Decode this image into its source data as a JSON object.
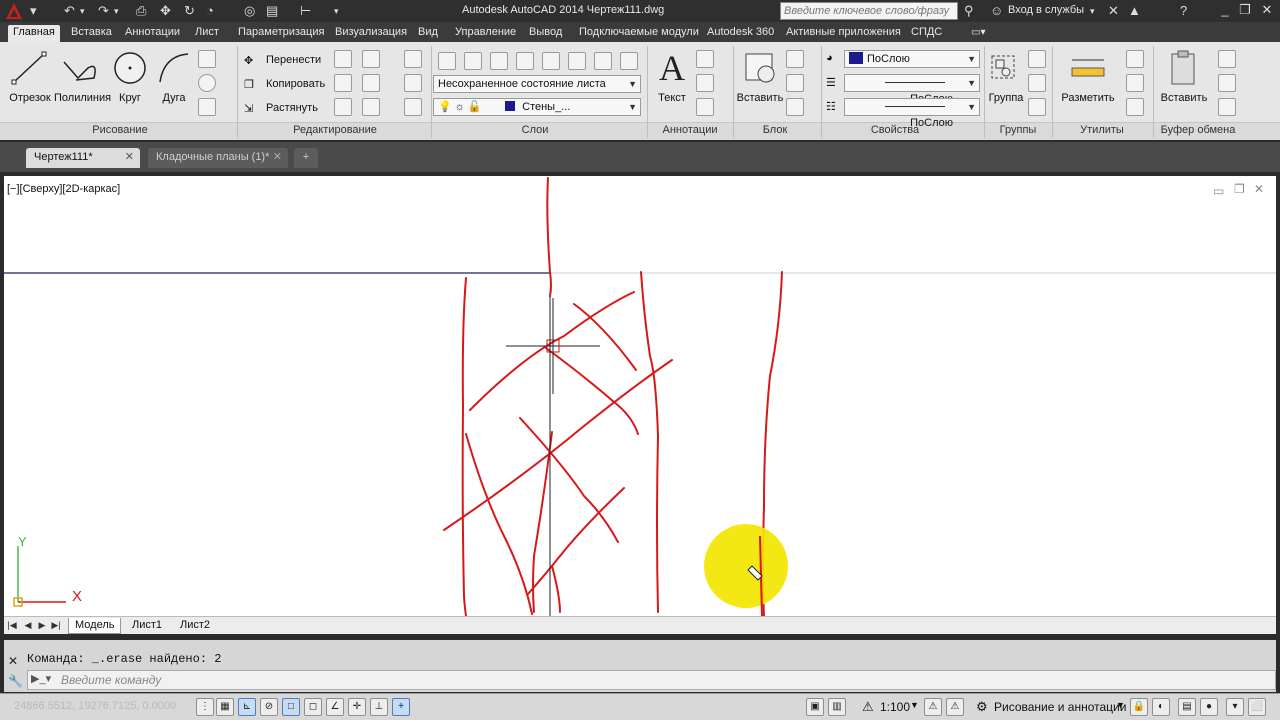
{
  "window": {
    "title": "Autodesk AutoCAD 2014   Чертеж111.dwg",
    "search_placeholder": "Введите ключевое слово/фразу",
    "signin_label": "Вход в службы",
    "logo_letter": "A"
  },
  "ribbon_tabs": [
    "Главная",
    "Вставка",
    "Аннотации",
    "Лист",
    "Параметризация",
    "Визуализация",
    "Вид",
    "Управление",
    "Вывод",
    "Подключаемые модули",
    "Autodesk 360",
    "Активные приложения",
    "СПДС"
  ],
  "draw_panel": {
    "tools": [
      "Отрезок",
      "Полилиния",
      "Круг",
      "Дуга"
    ],
    "title": "Рисование"
  },
  "modify_panel": {
    "move": "Перенести",
    "copy": "Копировать",
    "stretch": "Растянуть",
    "title": "Редактирование"
  },
  "layers_panel": {
    "layer_state": "Несохраненное состояние листа",
    "current_layer": "Стены_...",
    "title": "Слои"
  },
  "annotation_panel": {
    "text_tool": "Текст",
    "title": "Аннотации"
  },
  "block_panel": {
    "insert_tool": "Вставить",
    "title": "Блок"
  },
  "properties_panel": {
    "color": "ПоСлою",
    "linetype": "ПоСлою",
    "lineweight": "ПоСлою",
    "title": "Свойства"
  },
  "groups_panel": {
    "group_tool": "Группа",
    "title": "Группы"
  },
  "utilities_panel": {
    "measure_tool": "Разметить",
    "title": "Утилиты"
  },
  "clipboard_panel": {
    "paste_tool": "Вставить",
    "title": "Буфер обмена"
  },
  "doc_tabs": [
    {
      "label": "Чертеж111*",
      "active": true,
      "close": "✕"
    },
    {
      "label": "Кладочные планы (1)*",
      "active": false,
      "close": "✕"
    }
  ],
  "viewport_label": "[−][Сверху][2D-каркас]",
  "ucs": {
    "x_label": "X",
    "y_label": "Y"
  },
  "layout_tabs": [
    "Модель",
    "Лист1",
    "Лист2"
  ],
  "command": {
    "history": "Команда:  _.erase найдено: 2",
    "placeholder": "Введите команду"
  },
  "status": {
    "coordinates": "24866.5512, 19276.7125, 0.0000",
    "scale": "1:100",
    "workspace": "Рисование и аннотации"
  },
  "colors": {
    "sketch_red": "#d81818",
    "highlight_yellow": "#f2e600",
    "ribbon_bg": "#e6e6e6",
    "title_bg": "#2f2f2f",
    "layer_color": "#1a1a8c"
  }
}
